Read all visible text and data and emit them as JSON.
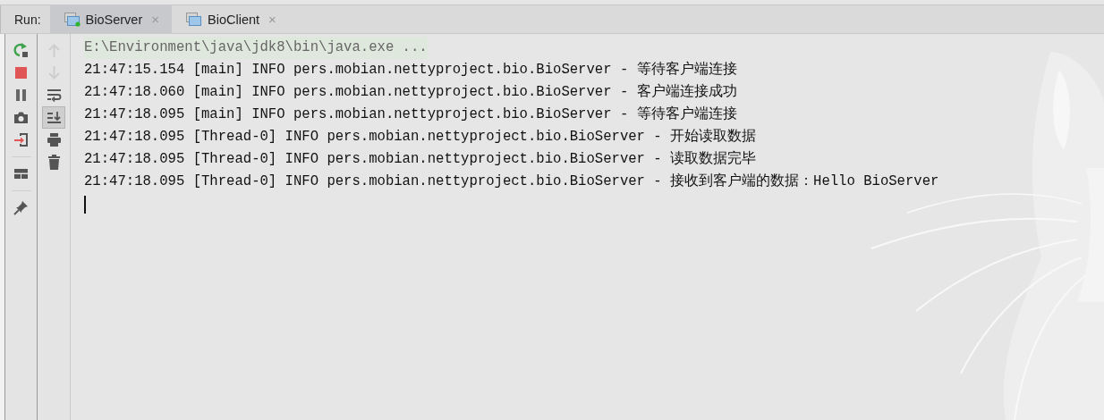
{
  "run_panel": {
    "label": "Run:",
    "tabs": [
      {
        "label": "BioServer",
        "selected": true,
        "running": true,
        "close": "×"
      },
      {
        "label": "BioClient",
        "selected": false,
        "running": false,
        "close": "×"
      }
    ]
  },
  "main_toolbar": [
    {
      "kind": "rerun",
      "disabled": false
    },
    {
      "kind": "stop",
      "disabled": false
    },
    {
      "kind": "pause",
      "disabled": false
    },
    {
      "kind": "camera",
      "disabled": false
    },
    {
      "kind": "exit",
      "disabled": false
    },
    {
      "kind": "separator"
    },
    {
      "kind": "layout",
      "disabled": false
    },
    {
      "kind": "separator"
    },
    {
      "kind": "pin",
      "disabled": false
    }
  ],
  "side_toolbar": [
    {
      "kind": "up",
      "disabled": true,
      "on": false
    },
    {
      "kind": "down",
      "disabled": true,
      "on": false
    },
    {
      "kind": "wrap",
      "disabled": false,
      "on": false
    },
    {
      "kind": "scroll-end",
      "disabled": false,
      "on": true
    },
    {
      "kind": "print",
      "disabled": false,
      "on": false
    },
    {
      "kind": "trash",
      "disabled": false,
      "on": false
    }
  ],
  "console": {
    "lines": [
      {
        "kind": "command",
        "text": "E:\\Environment\\java\\jdk8\\bin\\java.exe ..."
      },
      {
        "kind": "log",
        "text": "21:47:15.154 [main] INFO pers.mobian.nettyproject.bio.BioServer - 等待客户端连接"
      },
      {
        "kind": "log",
        "text": "21:47:18.060 [main] INFO pers.mobian.nettyproject.bio.BioServer - 客户端连接成功"
      },
      {
        "kind": "log",
        "text": "21:47:18.095 [main] INFO pers.mobian.nettyproject.bio.BioServer - 等待客户端连接"
      },
      {
        "kind": "log",
        "text": "21:47:18.095 [Thread-0] INFO pers.mobian.nettyproject.bio.BioServer - 开始读取数据"
      },
      {
        "kind": "log",
        "text": "21:47:18.095 [Thread-0] INFO pers.mobian.nettyproject.bio.BioServer - 读取数据完毕"
      },
      {
        "kind": "log",
        "text": "21:47:18.095 [Thread-0] INFO pers.mobian.nettyproject.bio.BioServer - 接收到客户端的数据：Hello BioServer"
      }
    ],
    "caret": true
  }
}
